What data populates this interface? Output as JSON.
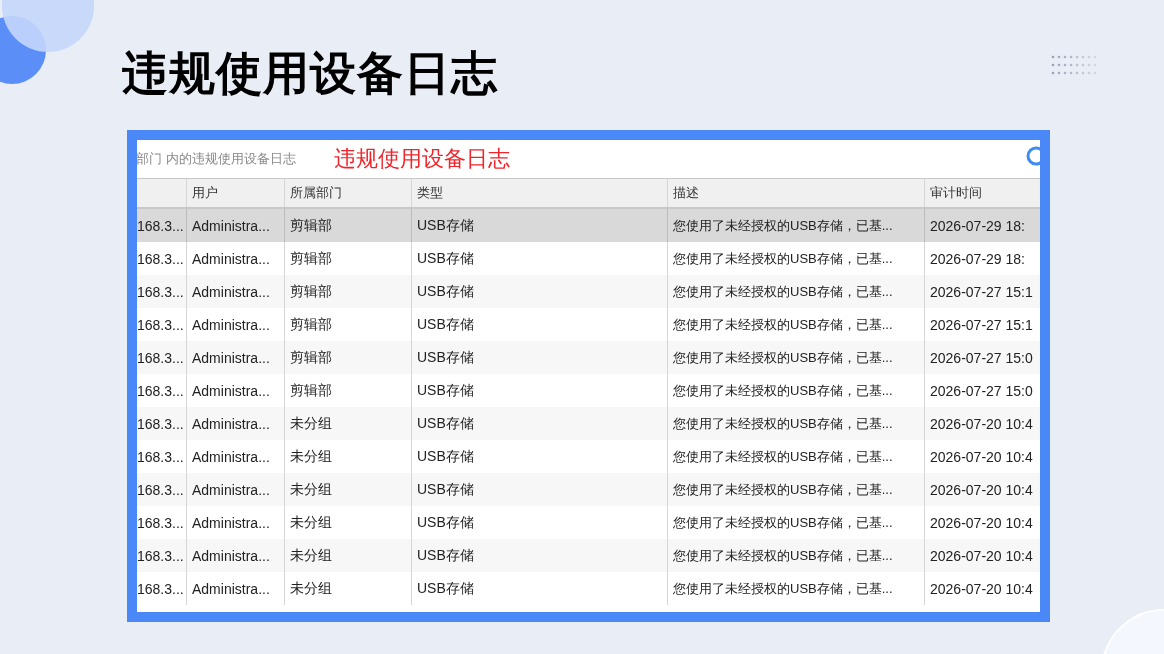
{
  "slide_title": "违规使用设备日志",
  "log_window": {
    "caption": "部门 内的违规使用设备日志",
    "annotation": "违规使用设备日志",
    "table": {
      "columns": [
        "",
        "用户",
        "所属部门",
        "类型",
        "描述",
        "审计时间"
      ],
      "rows": [
        {
          "cells": [
            "168.3...",
            "Administra...",
            "剪辑部",
            "USB存储",
            "您使用了未经授权的USB存储，已基...",
            "2026-07-29 18:"
          ],
          "selected": true
        },
        {
          "cells": [
            "168.3...",
            "Administra...",
            "剪辑部",
            "USB存储",
            "您使用了未经授权的USB存储，已基...",
            "2026-07-29 18:"
          ],
          "selected": false
        },
        {
          "cells": [
            "168.3...",
            "Administra...",
            "剪辑部",
            "USB存储",
            "您使用了未经授权的USB存储，已基...",
            "2026-07-27 15:1"
          ],
          "selected": false
        },
        {
          "cells": [
            "168.3...",
            "Administra...",
            "剪辑部",
            "USB存储",
            "您使用了未经授权的USB存储，已基...",
            "2026-07-27 15:1"
          ],
          "selected": false
        },
        {
          "cells": [
            "168.3...",
            "Administra...",
            "剪辑部",
            "USB存储",
            "您使用了未经授权的USB存储，已基...",
            "2026-07-27 15:0"
          ],
          "selected": false
        },
        {
          "cells": [
            "168.3...",
            "Administra...",
            "剪辑部",
            "USB存储",
            "您使用了未经授权的USB存储，已基...",
            "2026-07-27 15:0"
          ],
          "selected": false
        },
        {
          "cells": [
            "168.3...",
            "Administra...",
            "未分组",
            "USB存储",
            "您使用了未经授权的USB存储，已基...",
            "2026-07-20 10:4"
          ],
          "selected": false
        },
        {
          "cells": [
            "168.3...",
            "Administra...",
            "未分组",
            "USB存储",
            "您使用了未经授权的USB存储，已基...",
            "2026-07-20 10:4"
          ],
          "selected": false
        },
        {
          "cells": [
            "168.3...",
            "Administra...",
            "未分组",
            "USB存储",
            "您使用了未经授权的USB存储，已基...",
            "2026-07-20 10:4"
          ],
          "selected": false
        },
        {
          "cells": [
            "168.3...",
            "Administra...",
            "未分组",
            "USB存储",
            "您使用了未经授权的USB存储，已基...",
            "2026-07-20 10:4"
          ],
          "selected": false
        },
        {
          "cells": [
            "168.3...",
            "Administra...",
            "未分组",
            "USB存储",
            "您使用了未经授权的USB存储，已基...",
            "2026-07-20 10:4"
          ],
          "selected": false
        },
        {
          "cells": [
            "168.3...",
            "Administra...",
            "未分组",
            "USB存储",
            "您使用了未经授权的USB存储，已基...",
            "2026-07-20 10:4"
          ],
          "selected": false
        }
      ]
    }
  }
}
